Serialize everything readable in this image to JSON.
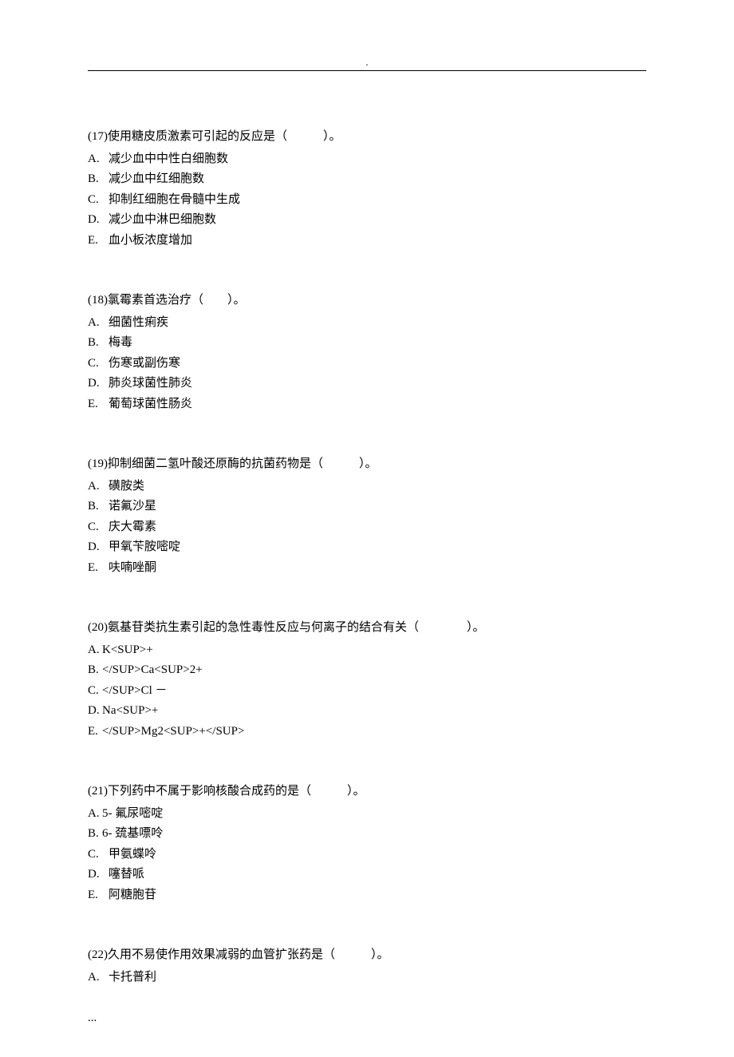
{
  "header": {
    "dot": "."
  },
  "questions": [
    {
      "stem": "(17)使用糖皮质激素可引起的反应是（　　　）。",
      "options": [
        {
          "label": "A.",
          "text": "减少血中中性白细胞数"
        },
        {
          "label": "B.",
          "text": "减少血中红细胞数"
        },
        {
          "label": "C.",
          "text": "抑制红细胞在骨髓中生成"
        },
        {
          "label": "D.",
          "text": "减少血中淋巴细胞数"
        },
        {
          "label": "E.",
          "text": "血小板浓度增加"
        }
      ],
      "spaced": true
    },
    {
      "stem": "(18)氯霉素首选治疗（　　）。",
      "options": [
        {
          "label": "A.",
          "text": "细菌性痢疾"
        },
        {
          "label": "B.",
          "text": "梅毒"
        },
        {
          "label": "C.",
          "text": "伤寒或副伤寒"
        },
        {
          "label": "D.",
          "text": "肺炎球菌性肺炎"
        },
        {
          "label": "E.",
          "text": "葡萄球菌性肠炎"
        }
      ],
      "spaced": true
    },
    {
      "stem": "(19)抑制细菌二氢叶酸还原酶的抗菌药物是（　　　）。",
      "options": [
        {
          "label": "A.",
          "text": "磺胺类"
        },
        {
          "label": "B.",
          "text": "诺氟沙星"
        },
        {
          "label": "C.",
          "text": "庆大霉素"
        },
        {
          "label": "D.",
          "text": "甲氧苄胺嘧啶"
        },
        {
          "label": "E.",
          "text": "呋喃唑酮"
        }
      ],
      "spaced": true
    },
    {
      "stem": "(20)氨基苷类抗生素引起的急性毒性反应与何离子的结合有关（　　　　）。",
      "options": [
        {
          "label": "A.",
          "text": "K<SUP>+"
        },
        {
          "label": "B.",
          "text": "</SUP>Ca<SUP>2+"
        },
        {
          "label": "C.",
          "text": "</SUP>Cl －"
        },
        {
          "label": "D.",
          "text": "Na<SUP>+"
        },
        {
          "label": "E.",
          "text": "</SUP>Mg2<SUP>+</SUP>"
        }
      ],
      "spaced": false
    },
    {
      "stem": "(21)下列药中不属于影响核酸合成药的是（　　　）。",
      "options": [
        {
          "label": "A.",
          "text": "5- 氟尿嘧啶"
        },
        {
          "label": "B.",
          "text": "6- 巯基嘌呤"
        },
        {
          "label": "C.",
          "text": "甲氨蝶呤"
        },
        {
          "label": "D.",
          "text": "噻替哌"
        },
        {
          "label": "E.",
          "text": "阿糖胞苷"
        }
      ],
      "spaced": "mixed"
    },
    {
      "stem": "(22)久用不易使作用效果减弱的血管扩张药是（　　　）。",
      "options": [
        {
          "label": "A.",
          "text": "卡托普利"
        }
      ],
      "spaced": true
    }
  ],
  "footer": {
    "ellipsis": "..."
  }
}
